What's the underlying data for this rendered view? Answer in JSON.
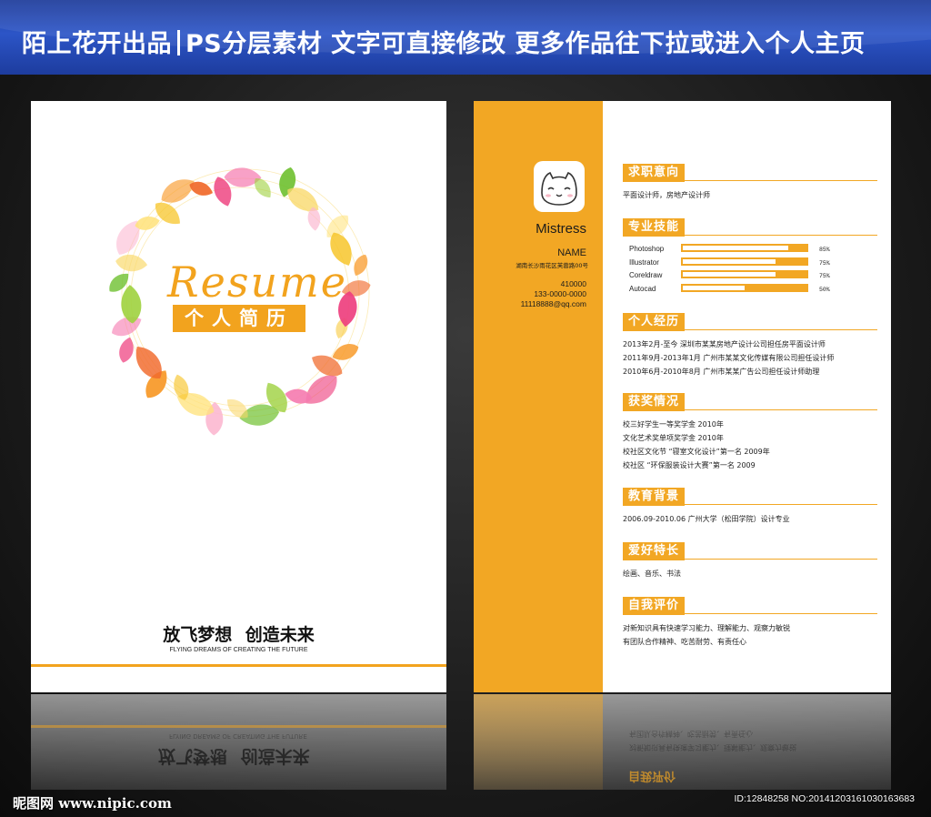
{
  "banner": {
    "brand": "陌上花开出品",
    "tagline": "PS分层素材 文字可直接修改  更多作品往下拉或进入个人主页"
  },
  "cover": {
    "script_title": "Resume",
    "badge": "个人简历",
    "slogan": "放飞梦想  创造未来",
    "slogan_en": "FLYING DREAMS OF CREATING THE FUTURE",
    "accent_color": "#f2a31e"
  },
  "resume": {
    "accent_color": "#f2a724",
    "avatar_icon": "cat-face-icon",
    "name_en": "Mistress",
    "name_label": "NAME",
    "address": "湖南长沙雨花区芙蓉路00号",
    "postcode": "410000",
    "phone": "133-0000-0000",
    "email": "11118888@qq.com",
    "sections": {
      "objective": {
        "title": "求职意向",
        "lines": [
          "平面设计师，房地产设计师"
        ]
      },
      "skills": {
        "title": "专业技能",
        "items": [
          {
            "name": "Photoshop",
            "percent": "85%",
            "level": 0.85
          },
          {
            "name": "Illustrator",
            "percent": "75%",
            "level": 0.75
          },
          {
            "name": "Coreldraw",
            "percent": "75%",
            "level": 0.75
          },
          {
            "name": "Autocad",
            "percent": "50%",
            "level": 0.5
          }
        ]
      },
      "experience": {
        "title": "个人经历",
        "lines": [
          "2013年2月-至今  深圳市某某房地产设计公司担任房平面设计师",
          "2011年9月-2013年1月  广州市某某文化传媒有限公司担任设计师",
          "2010年6月-2010年8月  广州市某某广告公司担任设计师助理"
        ]
      },
      "awards": {
        "title": "获奖情况",
        "lines": [
          "校三好学生一等奖学金  2010年",
          "文化艺术奖单项奖学金  2010年",
          "校社区文化节 “寝室文化设计”第一名 2009年",
          "校社区 “环保服装设计大赛”第一名 2009"
        ]
      },
      "education": {
        "title": "教育背景",
        "lines": [
          "2006.09-2010.06 广州大学（松田学院）设计专业"
        ]
      },
      "hobbies": {
        "title": "爱好特长",
        "lines": [
          "绘画、音乐、书法"
        ]
      },
      "self_eval": {
        "title": "自我评价",
        "lines": [
          "对新知识具有快速学习能力、理解能力、观察力敏锐",
          "有团队合作精神、吃苦耐劳、有责任心"
        ]
      }
    }
  },
  "footer": {
    "watermark": "昵图网 www.nipic.com",
    "image_id": "ID:12848258 NO:20141203161030163683"
  }
}
